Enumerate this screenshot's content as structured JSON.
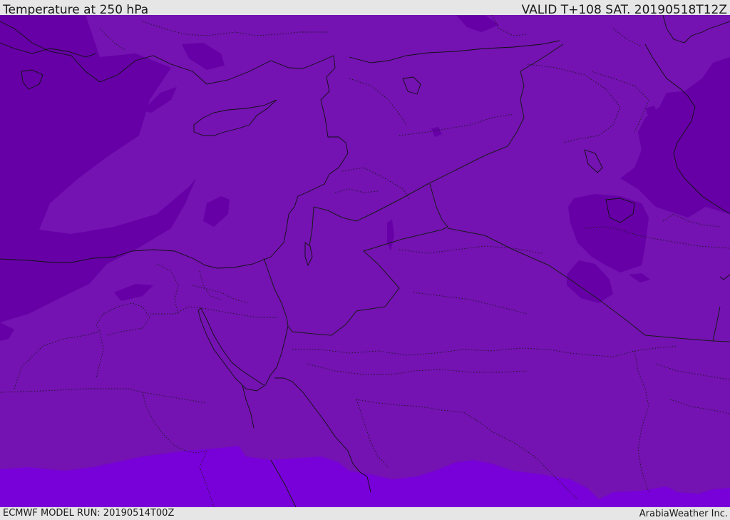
{
  "header": {
    "title": "Temperature at 250 hPa",
    "valid": "VALID T+108 SAT. 20190518T12Z"
  },
  "footer": {
    "model_run": "ECMWF MODEL RUN: 20190514T00Z",
    "credit": "ArabiaWeather Inc."
  },
  "map": {
    "variable": "Temperature at 250 hPa",
    "colors": {
      "base": "#7412b2",
      "dark": "#6600a6",
      "light": "#7800d8",
      "coast": "#111111",
      "border": "#1a1a1a"
    }
  }
}
